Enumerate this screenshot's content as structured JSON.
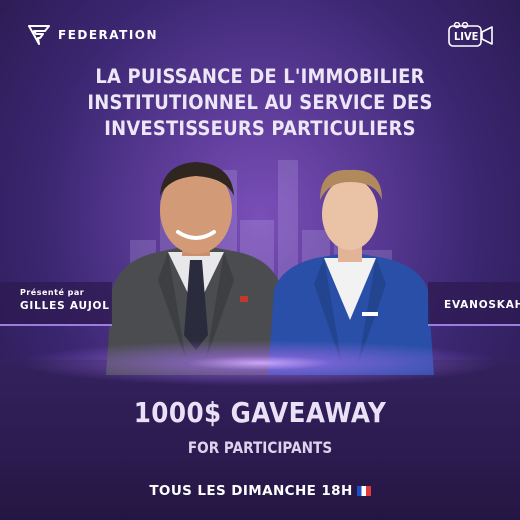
{
  "brand": {
    "name": "FEDERATION",
    "icon": "federation-logo-icon"
  },
  "live_badge": {
    "label": "LIVE",
    "icon": "live-camera-icon"
  },
  "headline": {
    "line1": "LA PUISSANCE DE L'IMMOBILIER",
    "line2": "INSTITUTIONNEL AU SERVICE DES",
    "line3": "INVESTISSEURS PARTICULIERS"
  },
  "presenter": {
    "caption": "Présenté par",
    "name": "GILLES AUJOL"
  },
  "guest": {
    "name": "EVANOSKAH"
  },
  "giveaway": {
    "title": "1000$ GAVEAWAY",
    "subtitle": "FOR PARTICIPANTS"
  },
  "schedule": {
    "label": "TOUS LES DIMANCHE 18H",
    "flag_icon": "france-flag-icon"
  },
  "colors": {
    "accent": "#9c7ee0",
    "background": "#3a2670",
    "glow": "#d2aaff"
  }
}
